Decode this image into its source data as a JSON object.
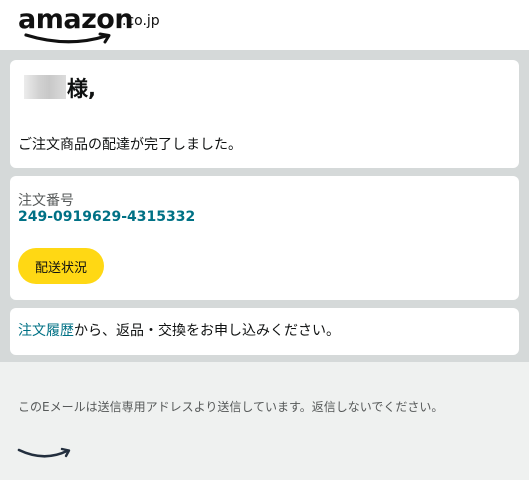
{
  "header": {
    "logo_word": "amazon",
    "logo_tld": ".co.jp",
    "logo_icon": "amazon-smile-icon"
  },
  "greeting": {
    "name_suffix": "様,",
    "message": "ご注文商品の配達が完了しました。"
  },
  "order": {
    "label": "注文番号",
    "number": "249-0919629-4315332",
    "status_button": "配送状況"
  },
  "history": {
    "link": "注文履歴",
    "rest": "から、返品・交換をお申し込みください。"
  },
  "footer": {
    "notice": "このEメールは送信専用アドレスより送信しています。返信しないでください。",
    "icon": "amazon-smile-icon"
  },
  "colors": {
    "link": "#007185",
    "button": "#ffd814",
    "background": "#d5d9d9",
    "footer": "#eff1f0"
  }
}
